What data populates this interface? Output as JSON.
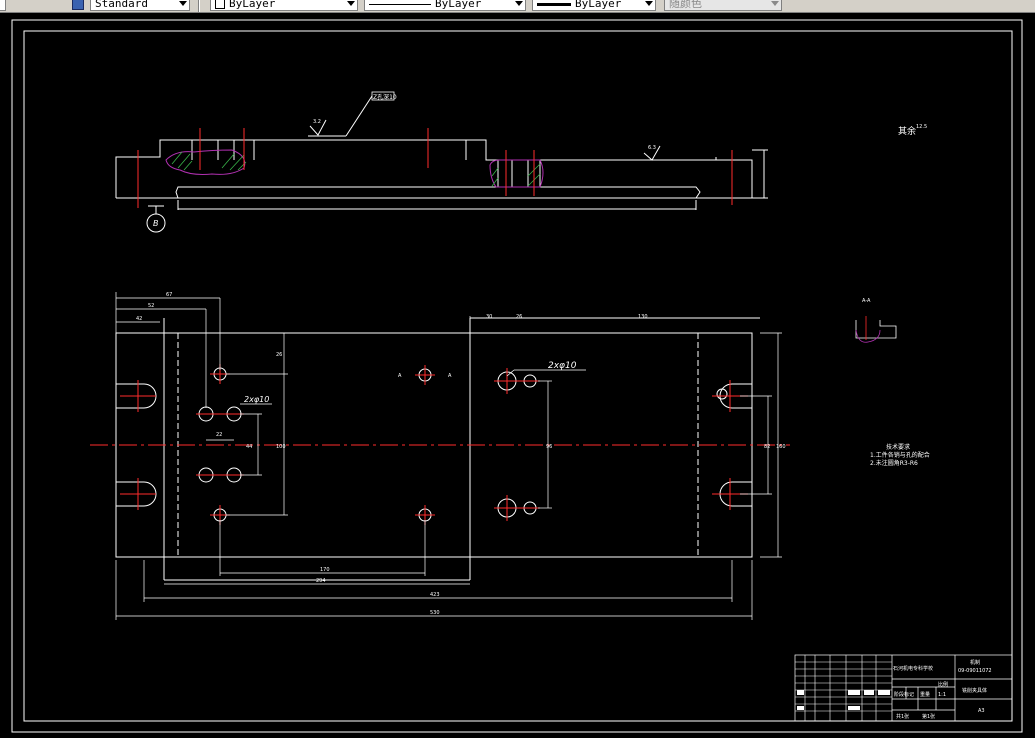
{
  "toolbar": {
    "text_style": "Standard",
    "layer_color": "ByLayer",
    "linetype": "ByLayer",
    "lineweight": "ByLayer",
    "plot_style": "随颜色"
  },
  "drawing": {
    "roughness_top": "3.2",
    "chamfer_note": "Z孔深10",
    "roughness_mid": "6.3",
    "datum_label": "B",
    "other_roughness_label": "其余",
    "other_roughness_value": "12.5",
    "section_label": "A-A",
    "section_letter_left": "A",
    "section_letter_right": "A",
    "hole_note_left": "2xφ10",
    "hole_note_right": "2xφ10",
    "tech_req_title": "技术要求",
    "tech_req_1": "1.工件各销与孔的配合",
    "tech_req_2": "2.未注圆角R3-R6"
  },
  "title_block": {
    "school": "石河机电专科学校",
    "drawing_no_label": "机制",
    "drawing_no": "09-09011072",
    "part_name": "铣削夹具体",
    "scale_label": "比例",
    "scale": "1:1",
    "stage_label": "阶段标记",
    "weight_label": "重量",
    "sheet_total": "共1张",
    "sheet_no": "第1张",
    "paper_size": "A3"
  }
}
